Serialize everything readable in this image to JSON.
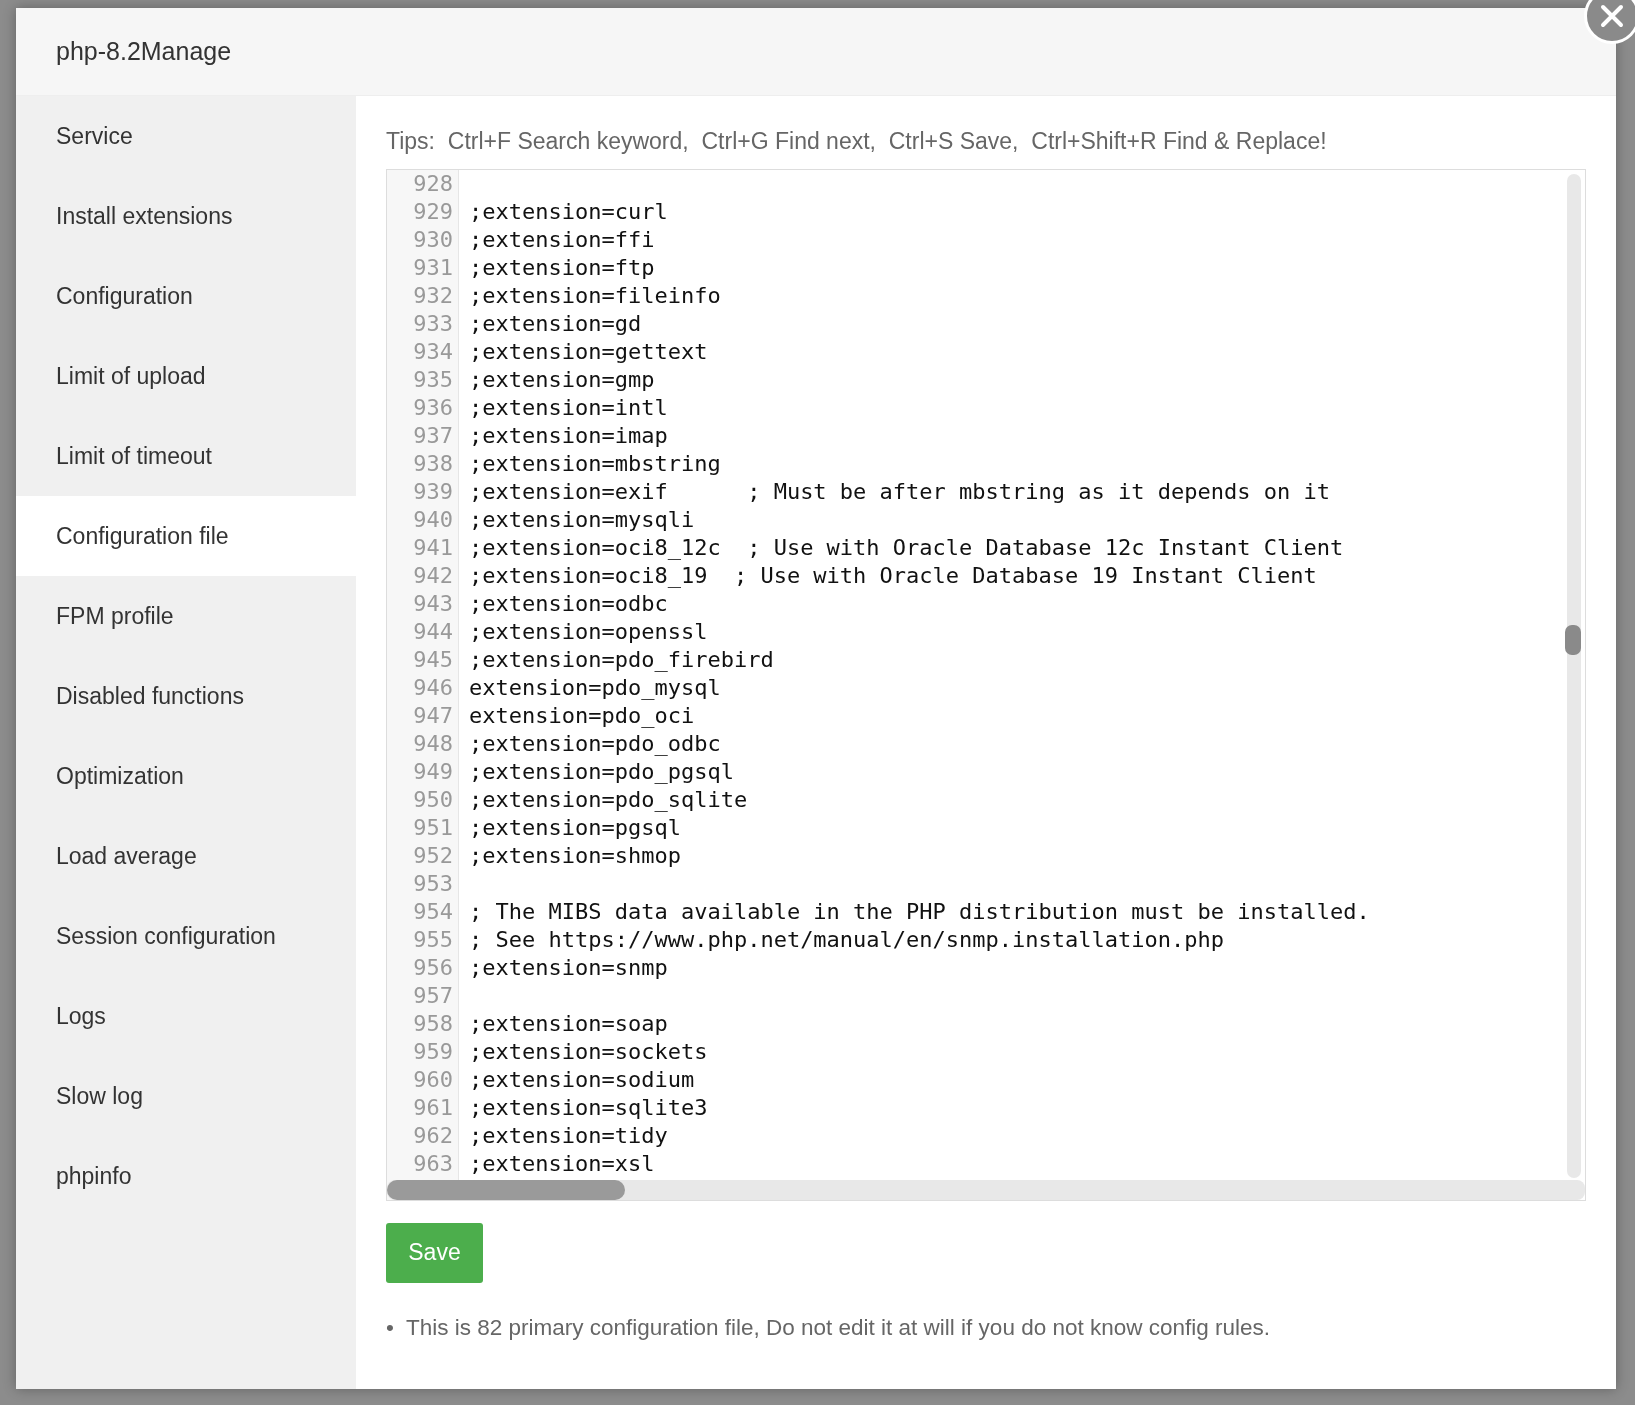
{
  "window": {
    "title": "php-8.2Manage"
  },
  "sidebar": {
    "items": [
      {
        "label": "Service",
        "selected": false
      },
      {
        "label": "Install extensions",
        "selected": false
      },
      {
        "label": "Configuration",
        "selected": false
      },
      {
        "label": "Limit of upload",
        "selected": false
      },
      {
        "label": "Limit of timeout",
        "selected": false
      },
      {
        "label": "Configuration file",
        "selected": true
      },
      {
        "label": "FPM profile",
        "selected": false
      },
      {
        "label": "Disabled functions",
        "selected": false
      },
      {
        "label": "Optimization",
        "selected": false
      },
      {
        "label": "Load average",
        "selected": false
      },
      {
        "label": "Session configuration",
        "selected": false
      },
      {
        "label": "Logs",
        "selected": false
      },
      {
        "label": "Slow log",
        "selected": false
      },
      {
        "label": "phpinfo",
        "selected": false
      }
    ]
  },
  "tips": "Tips:  Ctrl+F Search keyword,  Ctrl+G Find next,  Ctrl+S Save,  Ctrl+Shift+R Find & Replace!",
  "editor": {
    "lines": [
      {
        "number": "928"
      },
      {
        "number": "929",
        "text": ";extension=curl"
      },
      {
        "number": "930",
        "text": ";extension=ffi"
      },
      {
        "number": "931",
        "text": ";extension=ftp"
      },
      {
        "number": "932",
        "text": ";extension=fileinfo"
      },
      {
        "number": "933",
        "text": ";extension=gd"
      },
      {
        "number": "934",
        "text": ";extension=gettext"
      },
      {
        "number": "935",
        "text": ";extension=gmp"
      },
      {
        "number": "936",
        "text": ";extension=intl"
      },
      {
        "number": "937",
        "text": ";extension=imap"
      },
      {
        "number": "938",
        "text": ";extension=mbstring"
      },
      {
        "number": "939",
        "text": ";extension=exif      ; Must be after mbstring as it depends on it"
      },
      {
        "number": "940",
        "text": ";extension=mysqli"
      },
      {
        "number": "941",
        "text": ";extension=oci8_12c  ; Use with Oracle Database 12c Instant Client"
      },
      {
        "number": "942",
        "text": ";extension=oci8_19  ; Use with Oracle Database 19 Instant Client"
      },
      {
        "number": "943",
        "text": ";extension=odbc"
      },
      {
        "number": "944",
        "text": ";extension=openssl"
      },
      {
        "number": "945",
        "text": ";extension=pdo_firebird"
      },
      {
        "number": "946",
        "text": "extension=pdo_mysql"
      },
      {
        "number": "947",
        "text": "extension=pdo_oci"
      },
      {
        "number": "948",
        "text": ";extension=pdo_odbc"
      },
      {
        "number": "949",
        "text": ";extension=pdo_pgsql"
      },
      {
        "number": "950",
        "text": ";extension=pdo_sqlite"
      },
      {
        "number": "951",
        "text": ";extension=pgsql"
      },
      {
        "number": "952",
        "text": ";extension=shmop"
      },
      {
        "number": "953"
      },
      {
        "number": "954",
        "text": "; The MIBS data available in the PHP distribution must be installed."
      },
      {
        "number": "955",
        "text": "; See https://www.php.net/manual/en/snmp.installation.php"
      },
      {
        "number": "956",
        "text": ";extension=snmp"
      },
      {
        "number": "957"
      },
      {
        "number": "958",
        "text": ";extension=soap"
      },
      {
        "number": "959",
        "text": ";extension=sockets"
      },
      {
        "number": "960",
        "text": ";extension=sodium"
      },
      {
        "number": "961",
        "text": ";extension=sqlite3"
      },
      {
        "number": "962",
        "text": ";extension=tidy"
      },
      {
        "number": "963",
        "text": ";extension=xsl"
      }
    ]
  },
  "save_button": "Save",
  "notes": [
    {
      "bullet": "•",
      "text": "This is 82 primary configuration file, Do not edit it at will if you do not know config rules."
    }
  ]
}
